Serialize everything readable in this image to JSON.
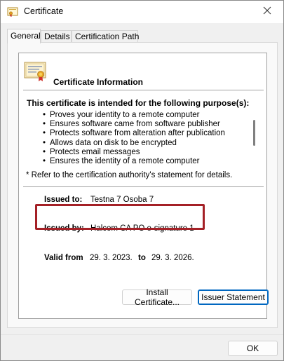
{
  "window": {
    "title": "Certificate",
    "title_icon": "certificate-icon",
    "close_icon": "close-icon"
  },
  "tabs": [
    {
      "label": "General",
      "active": true
    },
    {
      "label": "Details",
      "active": false
    },
    {
      "label": "Certification Path",
      "active": false
    }
  ],
  "info": {
    "title": "Certificate Information",
    "purpose_heading": "This certificate is intended for the following purpose(s):",
    "purposes": [
      "Proves your identity to a remote computer",
      "Ensures software came from software publisher",
      "Protects software from alteration after publication",
      "Allows data on disk to be encrypted",
      "Protects email messages",
      "Ensures the identity of a remote computer"
    ],
    "refer_note": "* Refer to the certification authority's statement for details.",
    "issued_to_label": "Issued to:",
    "issued_to_value": "Testna 7 Osoba 7",
    "issued_by_label": "Issued by:",
    "issued_by_value": "Halcom CA PO e-signature 1",
    "valid_from_label": "Valid from",
    "valid_from_value": "29. 3. 2023.",
    "valid_to_label": "to",
    "valid_to_value": "29. 3. 2026."
  },
  "buttons": {
    "install": "Install Certificate...",
    "issuer": "Issuer Statement",
    "ok": "OK"
  },
  "colors": {
    "highlight": "#a42026",
    "accent": "#0067c0"
  }
}
